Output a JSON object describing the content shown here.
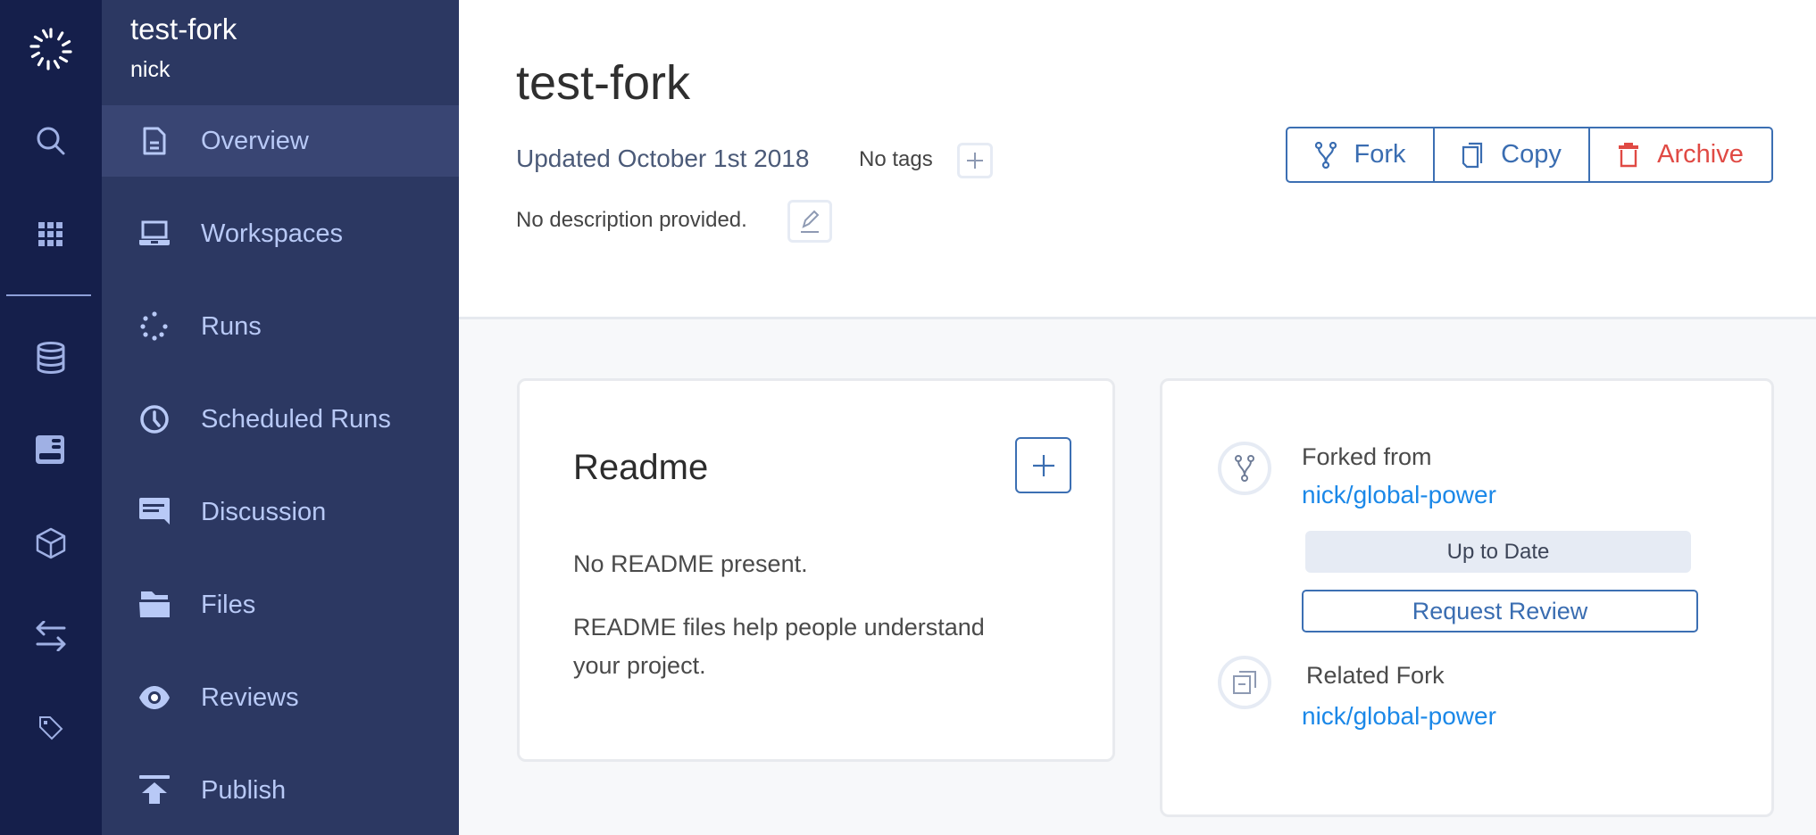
{
  "rail": {
    "items": [
      {
        "name": "logo-icon"
      },
      {
        "name": "search-icon"
      },
      {
        "name": "apps-grid-icon"
      },
      {
        "name": "database-icon"
      },
      {
        "name": "environment-icon"
      },
      {
        "name": "package-icon"
      },
      {
        "name": "transfer-arrows-icon"
      },
      {
        "name": "tag-icon"
      }
    ]
  },
  "project": {
    "name": "test-fork",
    "owner": "nick"
  },
  "sidebar": {
    "items": [
      {
        "label": "Overview",
        "icon": "document-icon",
        "active": true
      },
      {
        "label": "Workspaces",
        "icon": "laptop-icon",
        "active": false
      },
      {
        "label": "Runs",
        "icon": "spinner-dots-icon",
        "active": false
      },
      {
        "label": "Scheduled Runs",
        "icon": "clock-icon",
        "active": false
      },
      {
        "label": "Discussion",
        "icon": "chat-bubble-icon",
        "active": false
      },
      {
        "label": "Files",
        "icon": "folder-icon",
        "active": false
      },
      {
        "label": "Reviews",
        "icon": "eye-icon",
        "active": false
      },
      {
        "label": "Publish",
        "icon": "upload-icon",
        "active": false
      }
    ]
  },
  "header": {
    "title": "test-fork",
    "updated": "Updated October 1st 2018",
    "tags": "No tags",
    "description": "No description provided.",
    "buttons": {
      "fork": "Fork",
      "copy": "Copy",
      "archive": "Archive"
    }
  },
  "readme": {
    "title": "Readme",
    "empty": "No README present.",
    "help": "README files help people understand your project."
  },
  "fork_info": {
    "forked_from_label": "Forked from",
    "forked_from_link": "nick/global-power",
    "status": "Up to Date",
    "request_review": "Request Review",
    "related_label": "Related Fork",
    "related_link": "nick/global-power"
  },
  "colors": {
    "rail_bg": "#151f4b",
    "sidebar_bg": "#2c3862",
    "sidebar_active": "#394573",
    "sidebar_text": "#b8c9f6",
    "accent_blue": "#3a6db1",
    "link_blue": "#1b88e8",
    "danger_red": "#e04a44"
  }
}
